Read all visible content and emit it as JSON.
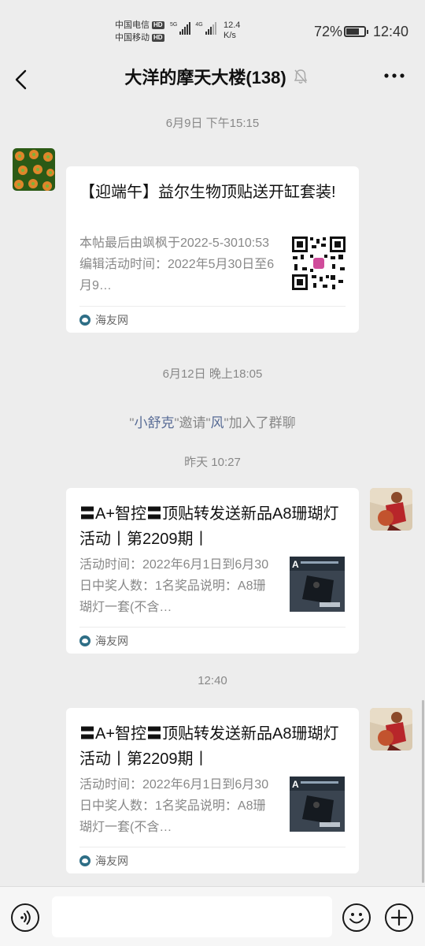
{
  "status_bar": {
    "carrier1": "中国电信",
    "carrier2": "中国移动",
    "hd_badge": "HD",
    "sig1_label": "5G",
    "sig2_label": "4G",
    "net_speed_value": "12.4",
    "net_speed_unit": "K/s",
    "battery_percent": "72%",
    "battery_level": 0.72,
    "time": "12:40"
  },
  "nav": {
    "title": "大洋的摩天大楼(138)"
  },
  "messages": {
    "ts1": "6月9日 下午15:15",
    "card1": {
      "title": "【迎端午】益尔生物顶贴送开缸套装!",
      "desc": "本帖最后由飒枫于2022-5-3010:53编辑活动时间：2022年5月30日至6月9…",
      "source": "海友网"
    },
    "ts2": "6月12日 晚上18:05",
    "sys": {
      "q1": "\"",
      "name1": "小舒克",
      "mid": "\"邀请\"",
      "name2": "风",
      "end": "\"加入了群聊"
    },
    "ts3": "昨天 10:27",
    "card2": {
      "title": "〓A+智控〓顶贴转发送新品A8珊瑚灯活动丨第2209期丨",
      "desc": "活动时间：2022年6月1日到6月30日中奖人数：1名奖品说明：A8珊瑚灯一套(不含…",
      "source": "海友网"
    },
    "ts4": "12:40",
    "card3": {
      "title": "〓A+智控〓顶贴转发送新品A8珊瑚灯活动丨第2209期丨",
      "desc": "活动时间：2022年6月1日到6月30日中奖人数：1名奖品说明：A8珊瑚灯一套(不含…",
      "source": "海友网"
    }
  },
  "icons": {
    "back": "chevron-left-icon",
    "mute": "bell-off-icon",
    "more": "more-icon",
    "voice": "voice-icon",
    "emoji": "emoji-icon",
    "plus": "plus-icon"
  }
}
